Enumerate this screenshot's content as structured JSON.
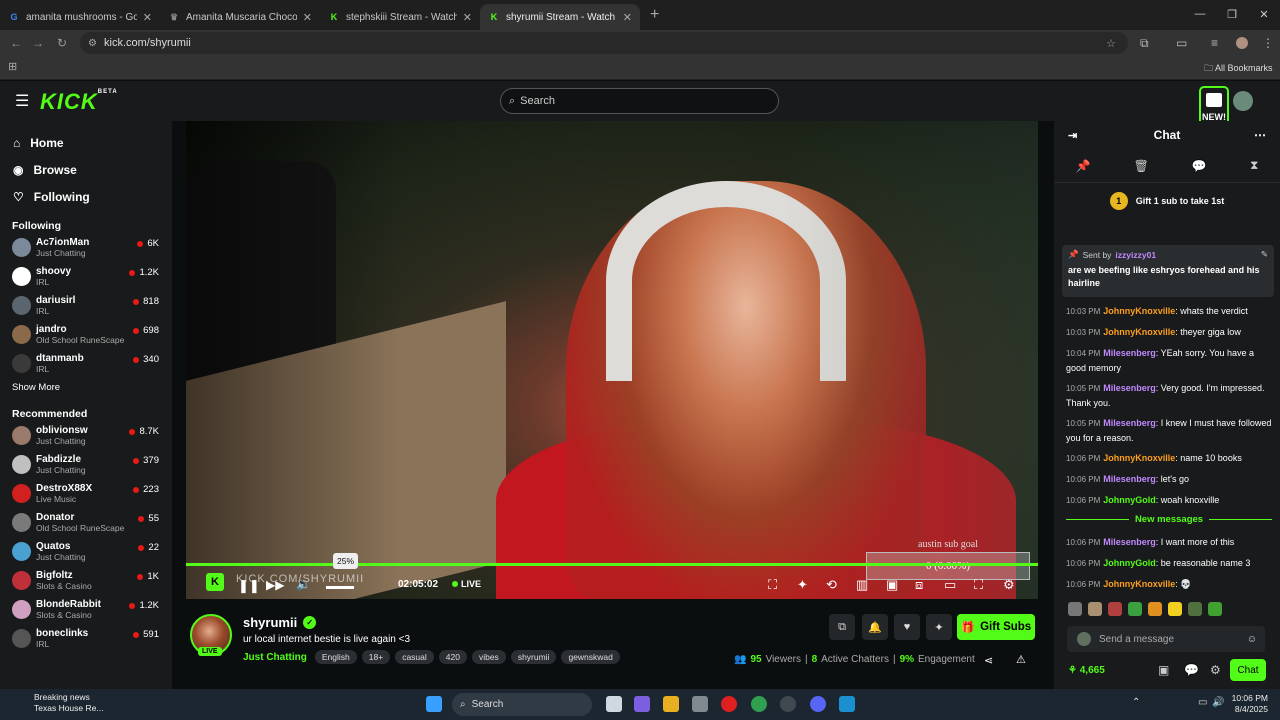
{
  "browser": {
    "tabs": [
      {
        "title": "amanita mushrooms - Google S",
        "color": "#4285f4",
        "glyph": "G"
      },
      {
        "title": "Amanita Muscaria Chocolate: Th",
        "color": "#888888",
        "glyph": "♛"
      },
      {
        "title": "stephskiii Stream - Watch Live o",
        "color": "#53fc18",
        "glyph": "K"
      },
      {
        "title": "shyrumii Stream - Watch Li",
        "color": "#53fc18",
        "glyph": "K"
      }
    ],
    "url": "kick.com/shyrumii",
    "bookmarks": "All Bookmarks"
  },
  "header": {
    "logo": "KICK",
    "logo_beta": "BETA",
    "search_placeholder": "Search",
    "new_badge": "NEW!"
  },
  "sidebar": {
    "nav": [
      {
        "label": "Home",
        "icon": "⌂"
      },
      {
        "label": "Browse",
        "icon": "◉"
      },
      {
        "label": "Following",
        "icon": "♡"
      }
    ],
    "following_heading": "Following",
    "following": [
      {
        "name": "Ac7ionMan",
        "category": "Just Chatting",
        "viewers": "6K",
        "color": "#7a8a9a"
      },
      {
        "name": "shoovy",
        "category": "IRL",
        "viewers": "1.2K",
        "color": "#ffffff"
      },
      {
        "name": "dariusirl",
        "category": "IRL",
        "viewers": "818",
        "color": "#5a6570"
      },
      {
        "name": "jandro",
        "category": "Old School RuneScape",
        "viewers": "698",
        "color": "#8a6a4a"
      },
      {
        "name": "dtanmanb",
        "category": "IRL",
        "viewers": "340",
        "color": "#3a3a3a"
      }
    ],
    "show_more": "Show More",
    "recommended_heading": "Recommended",
    "recommended": [
      {
        "name": "oblivionsw",
        "category": "Just Chatting",
        "viewers": "8.7K",
        "color": "#9a7a6a"
      },
      {
        "name": "Fabdizzle",
        "category": "Just Chatting",
        "viewers": "379",
        "color": "#c0c0c0"
      },
      {
        "name": "DestroX88X",
        "category": "Live Music",
        "viewers": "223",
        "color": "#d02020"
      },
      {
        "name": "Donator",
        "category": "Old School RuneScape",
        "viewers": "55",
        "color": "#7a7a7a"
      },
      {
        "name": "Quatos",
        "category": "Just Chatting",
        "viewers": "22",
        "color": "#4aa0d0"
      },
      {
        "name": "Bigfoltz",
        "category": "Slots & Casino",
        "viewers": "1K",
        "color": "#c0303a"
      },
      {
        "name": "BlondeRabbit",
        "category": "Slots & Casino",
        "viewers": "1.2K",
        "color": "#d0a0c0"
      },
      {
        "name": "boneclinks",
        "category": "IRL",
        "viewers": "591",
        "color": "#555555"
      }
    ]
  },
  "player": {
    "watermark": "KICK.COM/SHYRUMII",
    "volume_tooltip": "25%",
    "time": "02:05:02",
    "live": "LIVE",
    "goal_title": "austin sub goal",
    "goal_value": "0 (0.00%)"
  },
  "stream": {
    "name": "shyrumii",
    "live_badge": "LIVE",
    "title": "ur local internet bestie is live again <3",
    "category": "Just Chatting",
    "tags": [
      "English",
      "18+",
      "casual",
      "420",
      "vibes",
      "shyrumii",
      "gewnskwad"
    ],
    "gift_label": "Gift Subs",
    "viewers": "95",
    "viewers_label": "Viewers",
    "chatters": "8",
    "chatters_label": "Active Chatters",
    "engagement": "9%",
    "engagement_label": "Engagement"
  },
  "chat": {
    "title": "Chat",
    "gift_prompt": "Gift 1 sub to take 1st",
    "gift_rank": "1",
    "pinned_by_label": "Sent by",
    "pinned_user": "izzyizzy01",
    "pinned_message": "are we beefing like eshryos forehead and his hairline",
    "messages": [
      {
        "time": "10:03 PM",
        "user": "JohnnyKnoxville",
        "color": "#ff9f1c",
        "text": "whats the verdict"
      },
      {
        "time": "10:03 PM",
        "user": "JohnnyKnoxville",
        "color": "#ff9f1c",
        "text": "theyer giga low"
      },
      {
        "time": "10:04 PM",
        "user": "Milesenberg",
        "color": "#c289ff",
        "text": "YEah sorry. You have a good memory"
      },
      {
        "time": "10:05 PM",
        "user": "Milesenberg",
        "color": "#c289ff",
        "text": "Very good. I'm impressed. Thank you."
      },
      {
        "time": "10:05 PM",
        "user": "Milesenberg",
        "color": "#c289ff",
        "text": "I knew I must have followed you for a reason."
      },
      {
        "time": "10:06 PM",
        "user": "JohnnyKnoxville",
        "color": "#ff9f1c",
        "text": "name 10 books"
      },
      {
        "time": "10:06 PM",
        "user": "Milesenberg",
        "color": "#c289ff",
        "text": "let's go"
      },
      {
        "time": "10:06 PM",
        "user": "JohnnyGold",
        "color": "#53fc18",
        "text": "woah knoxville"
      }
    ],
    "new_messages_label": "New messages",
    "new_messages": [
      {
        "time": "10:06 PM",
        "user": "Milesenberg",
        "color": "#c289ff",
        "text": "I want more of this"
      },
      {
        "time": "10:06 PM",
        "user": "JohnnyGold",
        "color": "#53fc18",
        "text": "be reasonable name 3"
      },
      {
        "time": "10:06 PM",
        "user": "JohnnyKnoxville",
        "color": "#ff9f1c",
        "text": "💀"
      }
    ],
    "input_placeholder": "Send a message",
    "points": "4,665",
    "send_label": "Chat"
  },
  "taskbar": {
    "news_title": "Breaking news",
    "news_sub": "Texas House Re...",
    "search": "Search",
    "time": "10:06 PM",
    "date": "8/4/2025"
  }
}
